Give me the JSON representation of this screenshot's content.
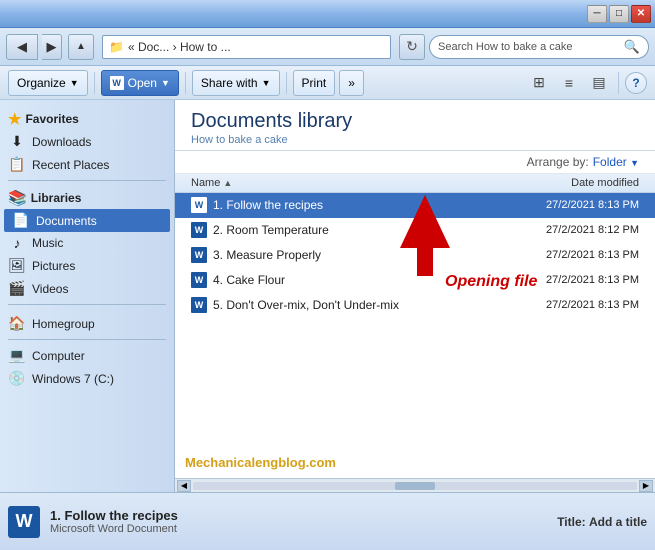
{
  "titlebar": {
    "minimize_label": "─",
    "maximize_label": "□",
    "close_label": "✕"
  },
  "addressbar": {
    "path_prefix": "« Doc... › How to ...",
    "path_full": "« Doc...  ›  How to ...",
    "search_placeholder": "Search How to bake a cake",
    "search_value": "Search How to bake a cake",
    "refresh_icon": "↻"
  },
  "toolbar": {
    "organize_label": "Organize",
    "open_label": "Open",
    "share_label": "Share with",
    "print_label": "Print",
    "more_label": "»",
    "help_label": "?"
  },
  "sidebar": {
    "favorites_label": "Favorites",
    "downloads_label": "Downloads",
    "recent_label": "Recent Places",
    "libraries_label": "Libraries",
    "documents_label": "Documents",
    "music_label": "Music",
    "pictures_label": "Pictures",
    "videos_label": "Videos",
    "homegroup_label": "Homegroup",
    "computer_label": "Computer",
    "windows_drive_label": "Windows 7 (C:)"
  },
  "content": {
    "library_title": "Documents library",
    "library_subtitle": "How to bake a cake",
    "arrange_label": "Arrange by:",
    "arrange_value": "Folder",
    "col_name": "Name",
    "col_date": "Date modified",
    "sort_arrow": "▲"
  },
  "files": [
    {
      "name": "1. Follow the recipes",
      "date": "27/2/2021 8:13 PM",
      "selected": true
    },
    {
      "name": "2. Room Temperature",
      "date": "27/2/2021 8:12 PM",
      "selected": false
    },
    {
      "name": "3. Measure Properly",
      "date": "27/2/2021 8:13 PM",
      "selected": false
    },
    {
      "name": "4. Cake Flour",
      "date": "27/2/2021 8:13 PM",
      "selected": false
    },
    {
      "name": "5. Don't Over-mix, Don't Under-mix",
      "date": "27/2/2021 8:13 PM",
      "selected": false
    }
  ],
  "annotation": {
    "opening_label": "Opening file"
  },
  "website": {
    "label": "Mechanicalengblog.com"
  },
  "statusbar": {
    "filename": "1. Follow the recipes",
    "filetype": "Microsoft Word Document",
    "meta_label": "Title:",
    "meta_value": "Add a title"
  }
}
